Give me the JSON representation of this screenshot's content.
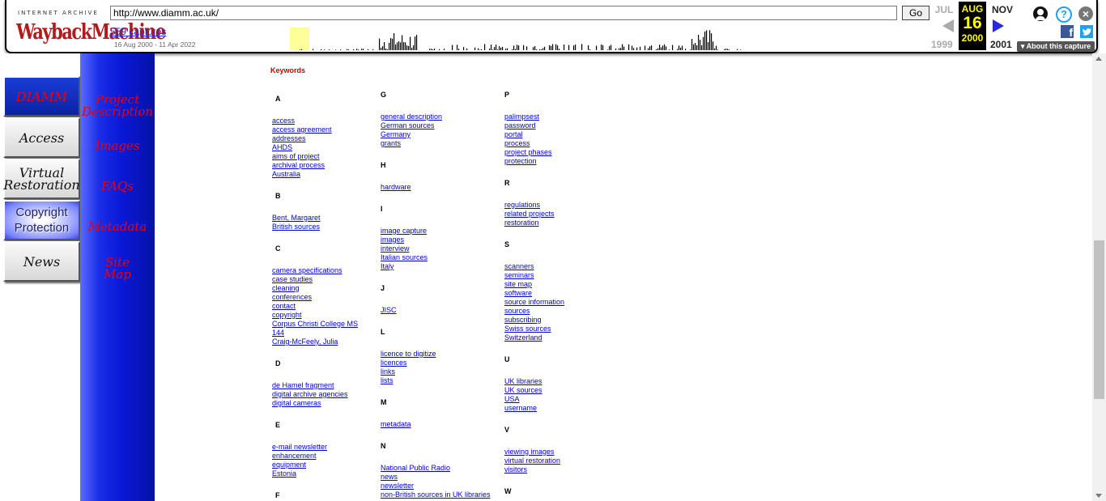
{
  "wayback": {
    "logo_top": "INTERNET ARCHIVE",
    "logo_main": "WaybackMachine",
    "url": "http://www.diamm.ac.uk/",
    "go_label": "Go",
    "captures": "559 captures",
    "range": "16 Aug 2000 - 11 Apr 2022",
    "prev_month": "JUL",
    "cur_month": "AUG",
    "cur_day": "16",
    "cur_year": "2000",
    "next_month": "NOV",
    "prev_year": "1999",
    "next_year": "2001",
    "about": "About this capture",
    "icons": [
      "user-icon",
      "help-icon",
      "close-icon",
      "facebook-icon",
      "twitter-icon"
    ]
  },
  "nav": {
    "diamm": "DIAMM",
    "access": "Access",
    "virtual_1": "Virtual",
    "virtual_2": "Restoration",
    "copyright_1": "Copyright",
    "copyright_2": "Protection",
    "news": "News"
  },
  "side": {
    "project_1": "Project",
    "project_2": "Description",
    "images": "Images",
    "faqs": "FAQs",
    "metadata": "Metadata",
    "site_1": "Site",
    "site_2": "Map"
  },
  "keywords": {
    "title": "Keywords",
    "columns": [
      [
        {
          "letter": "A",
          "links": [
            "access",
            "access agreement",
            "addresses",
            "AHDS",
            "aims of project",
            "archival process",
            "Australia"
          ]
        },
        {
          "letter": "B",
          "links": [
            "Bent, Margaret",
            "British sources"
          ]
        },
        {
          "letter": "C",
          "links": [
            "camera specifications",
            "case studies",
            "cleaning",
            "conferences",
            "contact",
            "copyright",
            "Corpus Christi College MS",
            "144",
            "Craig-McFeely, Julia"
          ]
        },
        {
          "letter": "D",
          "links": [
            "de Hamel fragment",
            "digital archive agencies",
            "digital cameras"
          ]
        },
        {
          "letter": "E",
          "links": [
            "e-mail newsletter",
            "enhancement",
            "equipment",
            "Estonia"
          ]
        },
        {
          "letter": "F",
          "links": []
        }
      ],
      [
        {
          "letter": "G",
          "links": [
            "general description",
            "German sources",
            "Germany",
            "grants"
          ]
        },
        {
          "letter": "H",
          "links": [
            "hardware"
          ]
        },
        {
          "letter": "I",
          "links": [
            "image capture",
            "images",
            "interview",
            "Italian sources",
            "Italy"
          ]
        },
        {
          "letter": "J",
          "links": [
            "JISC"
          ]
        },
        {
          "letter": "L",
          "links": [
            "licence to digitize",
            "licences",
            "links",
            "lists"
          ]
        },
        {
          "letter": "M",
          "links": [
            "metadata"
          ]
        },
        {
          "letter": "N",
          "links": [
            "National Public Radio",
            "news",
            "newsletter",
            "non-British sources in UK libraries"
          ]
        }
      ],
      [
        {
          "letter": "P",
          "links": [
            "palimpsest",
            "password",
            "portal",
            "process",
            "project phases",
            "protection"
          ]
        },
        {
          "letter": "R",
          "links": [
            "regulations",
            "related projects",
            "restoration"
          ]
        },
        {
          "letter": "S",
          "links": [
            "scanners",
            "seminars",
            "site map",
            "software",
            "source information",
            "sources",
            "subscribing",
            "Swiss sources",
            "Switzerland"
          ]
        },
        {
          "letter": "U",
          "links": [
            "UK libraries",
            "UK sources",
            "USA",
            "username"
          ]
        },
        {
          "letter": "V",
          "links": [
            "viewing images",
            "virtual restoration",
            "visitors"
          ]
        },
        {
          "letter": "W",
          "links": []
        }
      ]
    ]
  }
}
